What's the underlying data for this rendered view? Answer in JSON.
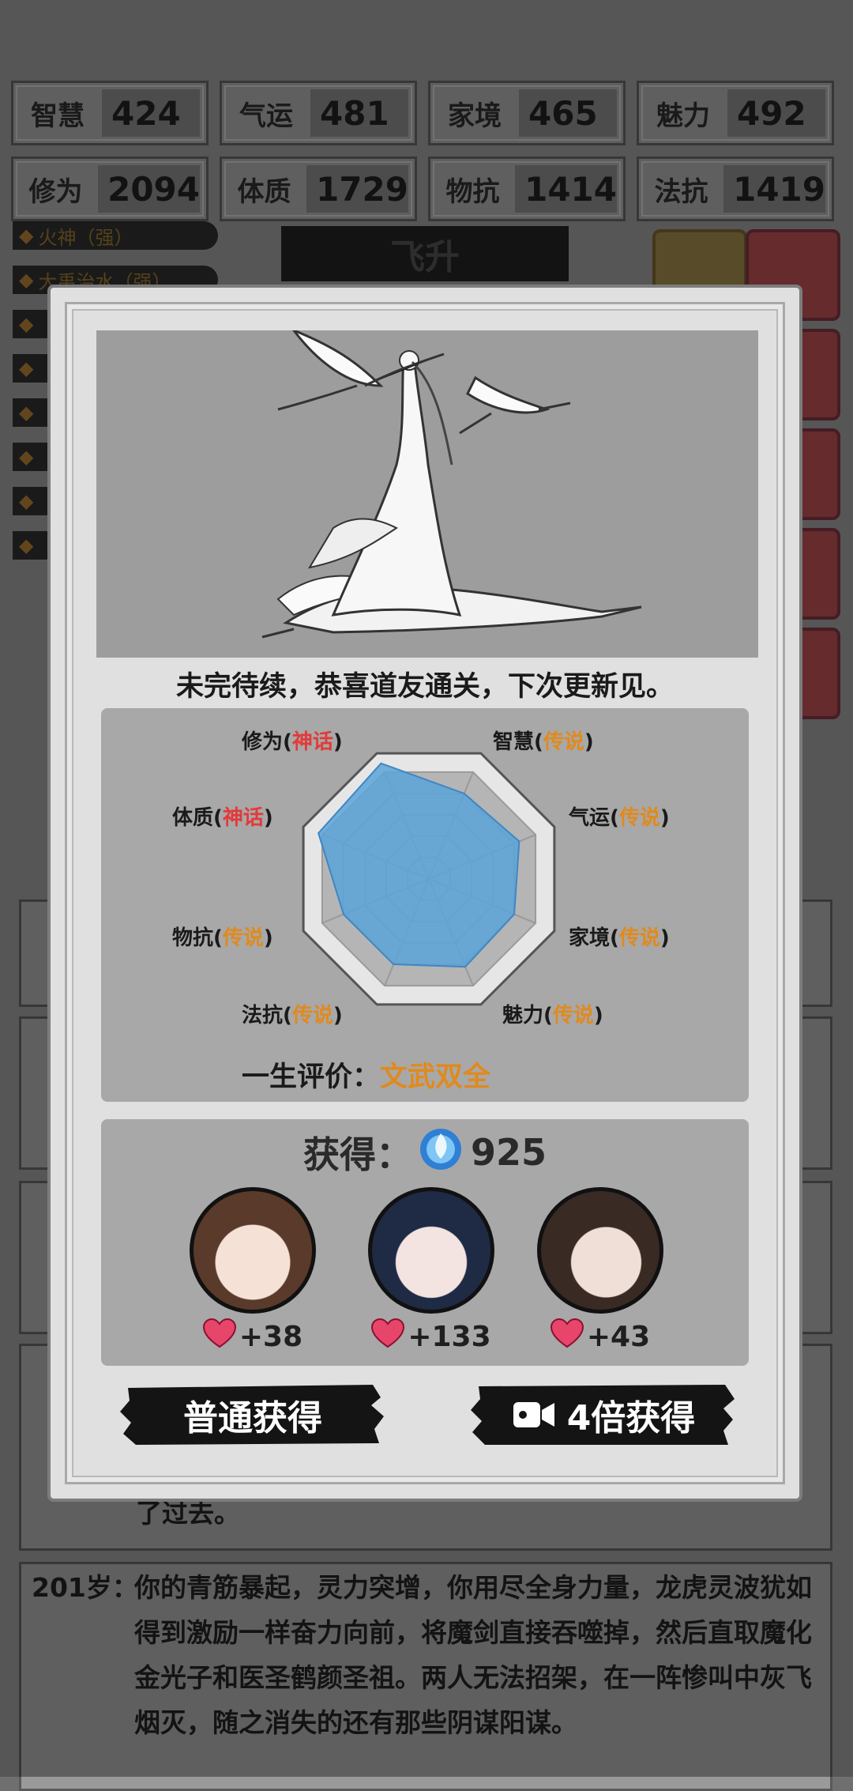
{
  "stats": [
    {
      "name": "智慧",
      "value": "424"
    },
    {
      "name": "气运",
      "value": "481"
    },
    {
      "name": "家境",
      "value": "465"
    },
    {
      "name": "魅力",
      "value": "492"
    },
    {
      "name": "修为",
      "value": "2094"
    },
    {
      "name": "体质",
      "value": "1729"
    },
    {
      "name": "物抗",
      "value": "1414"
    },
    {
      "name": "法抗",
      "value": "1419"
    }
  ],
  "skills": [
    "火神（强）",
    "大禹治水（强）"
  ],
  "section_title": "飞升",
  "modal": {
    "congrats": "未完待续，恭喜道友通关，下次更新见。",
    "radar": {
      "labels": [
        {
          "name": "修为",
          "rank": "神话",
          "tier": "mythic",
          "value": 0.92
        },
        {
          "name": "智慧",
          "rank": "传说",
          "tier": "legend",
          "value": 0.68
        },
        {
          "name": "气运",
          "rank": "传说",
          "tier": "legend",
          "value": 0.72
        },
        {
          "name": "家境",
          "rank": "传说",
          "tier": "legend",
          "value": 0.68
        },
        {
          "name": "魅力",
          "rank": "传说",
          "tier": "legend",
          "value": 0.7
        },
        {
          "name": "法抗",
          "rank": "传说",
          "tier": "legend",
          "value": 0.68
        },
        {
          "name": "物抗",
          "rank": "传说",
          "tier": "legend",
          "value": 0.68
        },
        {
          "name": "体质",
          "rank": "神话",
          "tier": "mythic",
          "value": 0.88
        }
      ],
      "open": "(",
      "close": ")"
    },
    "evaluation_label": "一生评价：",
    "evaluation_value": "文武双全",
    "reward_label": "获得：",
    "reward_amount": "925",
    "characters": [
      {
        "favor": "+38"
      },
      {
        "favor": "+133"
      },
      {
        "favor": "+43"
      }
    ],
    "normal_button": "普通获得",
    "ad_button": "4倍获得"
  },
  "log": {
    "prev_tail": "了过去。",
    "age": "201岁：",
    "text": "你的青筋暴起，灵力突增，你用尽全身力量，龙虎灵波犹如得到激励一样奋力向前，将魔剑直接吞噬掉，然后直取魔化金光子和医圣鹤颜圣祖。两人无法招架，在一阵惨叫中灰飞烟灭，随之消失的还有那些阴谋阳谋。"
  },
  "colors": {
    "mythic": "#e23a3a",
    "legend": "#e08a1e",
    "radar_fill": "#5aa3d8"
  }
}
